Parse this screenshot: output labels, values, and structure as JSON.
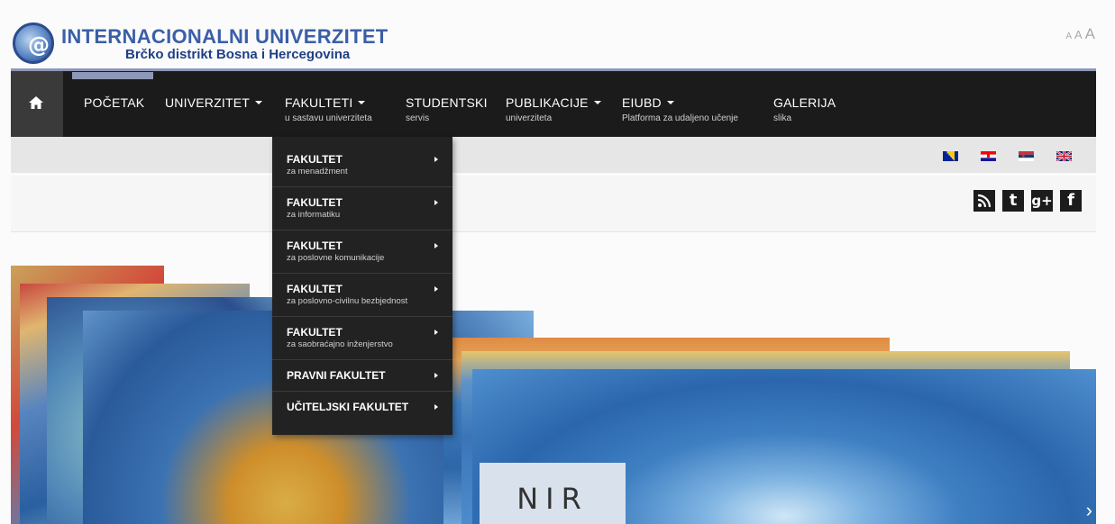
{
  "header": {
    "logo_title": "INTERNACIONALNI UNIVERZITET",
    "logo_subtitle": "Brčko distrikt Bosna i Hercegovina",
    "logo_glyph": "@"
  },
  "font_size_controls": [
    "A",
    "A",
    "A"
  ],
  "nav": {
    "home_icon": "home-icon",
    "items": [
      {
        "label": "POČETAK",
        "sub": "",
        "caret": false
      },
      {
        "label": "UNIVERZITET",
        "sub": "",
        "caret": true
      },
      {
        "label": "FAKULTETI",
        "sub": "u sastavu univerziteta",
        "caret": true
      },
      {
        "label": "STUDENTSKI",
        "sub": "servis",
        "caret": false
      },
      {
        "label": "PUBLIKACIJE",
        "sub": "univerziteta",
        "caret": true
      },
      {
        "label": "EIUBD",
        "sub": "Platforma za udaljeno učenje",
        "caret": true
      },
      {
        "label": "GALERIJA",
        "sub": "slika",
        "caret": false
      }
    ]
  },
  "dropdown": {
    "items": [
      {
        "label": "FAKULTET",
        "sub": "za menadžment"
      },
      {
        "label": "FAKULTET",
        "sub": "za informatiku"
      },
      {
        "label": "FAKULTET",
        "sub": "za poslovne komunikacije"
      },
      {
        "label": "FAKULTET",
        "sub": "za poslovno-civilnu bezbjednost"
      },
      {
        "label": "FAKULTET",
        "sub": "za saobraćajno inženjerstvo"
      },
      {
        "label": "PRAVNI FAKULTET",
        "sub": ""
      },
      {
        "label": "UČITELJSKI FAKULTET",
        "sub": ""
      }
    ]
  },
  "languages": [
    "bosnian-flag",
    "croatian-flag",
    "serbian-flag",
    "english-flag"
  ],
  "social": [
    {
      "icon": "rss-icon",
      "glyph": ""
    },
    {
      "icon": "twitter-icon",
      "glyph": "t"
    },
    {
      "icon": "google-plus-icon",
      "glyph": "g+"
    },
    {
      "icon": "facebook-icon",
      "glyph": "f"
    }
  ],
  "hero": {
    "caption": "NIR",
    "next_arrow": "›"
  },
  "colors": {
    "nav_bg": "#1b1b1b",
    "home_bg": "#3a3a3a",
    "accent": "#8e97b5",
    "dropdown_bg": "#222222",
    "logo_blue": "#3a5fa8"
  }
}
